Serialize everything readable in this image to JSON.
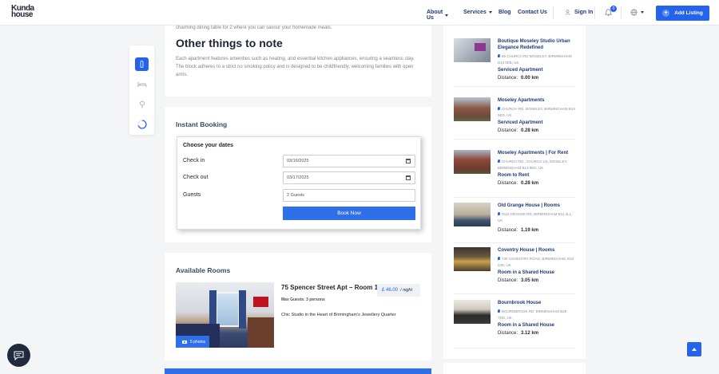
{
  "header": {
    "logo_line1": "Kunda",
    "logo_line2": "house",
    "nav": [
      "About Us",
      "Services",
      "Blog",
      "Contact Us"
    ],
    "signin": "Sign In",
    "notification_count": "0",
    "add_listing": "Add Listing"
  },
  "notes": {
    "prev_text": "charming dining table for 2 where you can savour your homemade meals.",
    "title": "Other things to note",
    "body": "Each apartment features amenities such as heating, and essential kitchen appliances, ensuring a seamless stay. The block adheres to a strict no smoking policy and is designed to be childfriendly, welcoming families with open arms."
  },
  "booking": {
    "section_title": "Instant Booking",
    "box_title": "Choose your dates",
    "checkin_label": "Check in",
    "checkin_value": "03/16/2025",
    "checkout_label": "Check out",
    "checkout_value": "03/17/2025",
    "guests_label": "Guests",
    "guests_value": "2 Guests",
    "button": "Book Now"
  },
  "rooms": {
    "section_title": "Available Rooms",
    "room_name": "75 Spencer Street Apt – Room 1",
    "price": "£ 46.00",
    "per": "/ night",
    "max_guests": "Max Guests: 3 persons",
    "description": "Chic Studio in the Heart of Birmingham's Jewellery Quarter",
    "photos": "5 photos"
  },
  "nearby": [
    {
      "title": "Boutique Moseley Studio Urban Elegance Redefined",
      "address": "65 CHURCH RD,MOSELEY, BIRMINGHAM B13 9EB, UK",
      "type": "Serviced Apartment",
      "distance_label": "Distance:",
      "distance": "0.00 km"
    },
    {
      "title": "Moseley Apartments",
      "address": "CHURCH RD, MOSELEY, BIRMINGHAM B13 9ED, UK",
      "type": "Serviced Apartment",
      "distance_label": "Distance:",
      "distance": "0.28 km"
    },
    {
      "title": "Moseley Apartments | For Rent",
      "address": "CHURCH RD., CHURCH LN, MOSELEY, BIRMINGHAM B13 9ED, UK",
      "type": "Room to Rent",
      "distance_label": "Distance:",
      "distance": "0.28 km"
    },
    {
      "title": "Old Grange House | Rooms",
      "address": "OLD GRANGE RD, BIRMINGHAM B11 4LL, UK",
      "type": "",
      "distance_label": "Distance:",
      "distance": "1.19 km"
    },
    {
      "title": "Coventry House | Rooms",
      "address": "730 COVENTRY ROAD, BIRMINGHAM, B10 0JD, UK",
      "type": "Room in a Shared House",
      "distance_label": "Distance:",
      "distance": "3.05 km"
    },
    {
      "title": "Bournbrook House",
      "address": "BOURNBROOK RD, BIRMINGHAM B29 7DD, UK",
      "type": "Room in a Shared House",
      "distance_label": "Distance:",
      "distance": "3.12 km"
    }
  ]
}
